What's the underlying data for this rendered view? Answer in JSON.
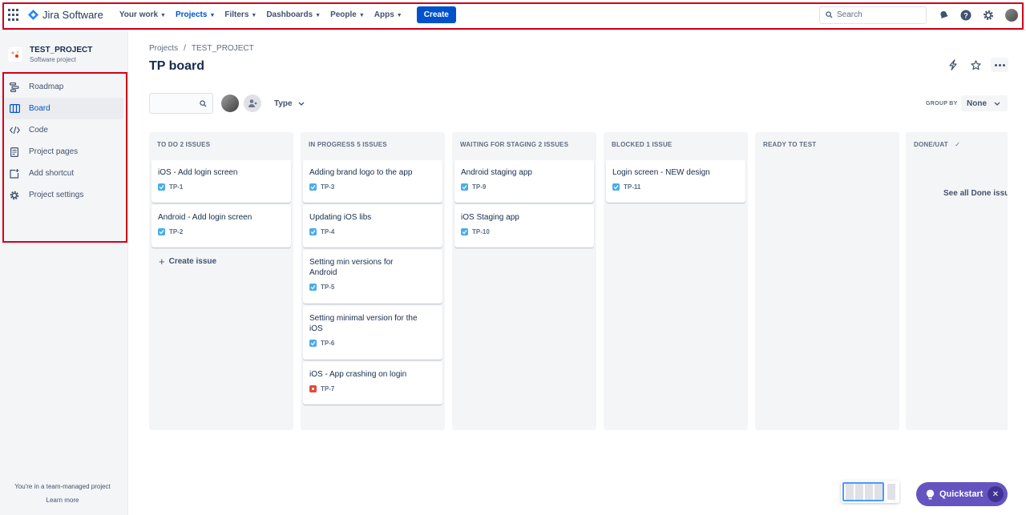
{
  "topnav": {
    "product": "Jira Software",
    "items": [
      {
        "label": "Your work",
        "active": false
      },
      {
        "label": "Projects",
        "active": true
      },
      {
        "label": "Filters",
        "active": false
      },
      {
        "label": "Dashboards",
        "active": false
      },
      {
        "label": "People",
        "active": false
      },
      {
        "label": "Apps",
        "active": false
      }
    ],
    "create_label": "Create",
    "search_placeholder": "Search"
  },
  "sidebar": {
    "project_name": "TEST_PROJECT",
    "project_type": "Software project",
    "items": [
      {
        "label": "Roadmap",
        "icon": "roadmap-icon"
      },
      {
        "label": "Board",
        "icon": "board-icon",
        "active": true
      },
      {
        "label": "Code",
        "icon": "code-icon"
      },
      {
        "label": "Project pages",
        "icon": "pages-icon"
      },
      {
        "label": "Add shortcut",
        "icon": "add-shortcut-icon"
      },
      {
        "label": "Project settings",
        "icon": "gear-icon"
      }
    ],
    "footer_text": "You're in a team-managed project",
    "learn_more": "Learn more"
  },
  "breadcrumb": [
    "Projects",
    "/",
    "TEST_PROJECT"
  ],
  "page_title": "TP board",
  "filters": {
    "type_label": "Type",
    "group_by_label": "GROUP BY",
    "group_by_value": "None"
  },
  "columns": [
    {
      "title": "TO DO 2 ISSUES",
      "cards": [
        {
          "title": "iOS - Add login screen",
          "key": "TP-1",
          "type": "task"
        },
        {
          "title": "Android - Add login screen",
          "key": "TP-2",
          "type": "task"
        }
      ],
      "create_issue": "Create issue"
    },
    {
      "title": "IN PROGRESS 5 ISSUES",
      "cards": [
        {
          "title": "Adding brand logo to the app",
          "key": "TP-3",
          "type": "task"
        },
        {
          "title": "Updating iOS libs",
          "key": "TP-4",
          "type": "task"
        },
        {
          "title": "Setting min versions for Android",
          "key": "TP-5",
          "type": "task"
        },
        {
          "title": "Setting minimal version for the iOS",
          "key": "TP-6",
          "type": "task"
        },
        {
          "title": "iOS - App crashing on login",
          "key": "TP-7",
          "type": "bug"
        }
      ]
    },
    {
      "title": "WAITING FOR STAGING 2 ISSUES",
      "cards": [
        {
          "title": "Android staging app",
          "key": "TP-9",
          "type": "task"
        },
        {
          "title": "iOS Staging app",
          "key": "TP-10",
          "type": "task"
        }
      ]
    },
    {
      "title": "BLOCKED 1 ISSUE",
      "cards": [
        {
          "title": "Login screen - NEW design",
          "key": "TP-11",
          "type": "task"
        }
      ]
    },
    {
      "title": "READY TO TEST",
      "cards": []
    },
    {
      "title": "DONE/UAT",
      "cards": [],
      "see_all": "See all Done issues"
    }
  ],
  "quickstart": {
    "label": "Quickstart"
  },
  "colors": {
    "brand": "#0052cc",
    "quickstart": "#6554c0",
    "highlight": "#d0021b"
  }
}
